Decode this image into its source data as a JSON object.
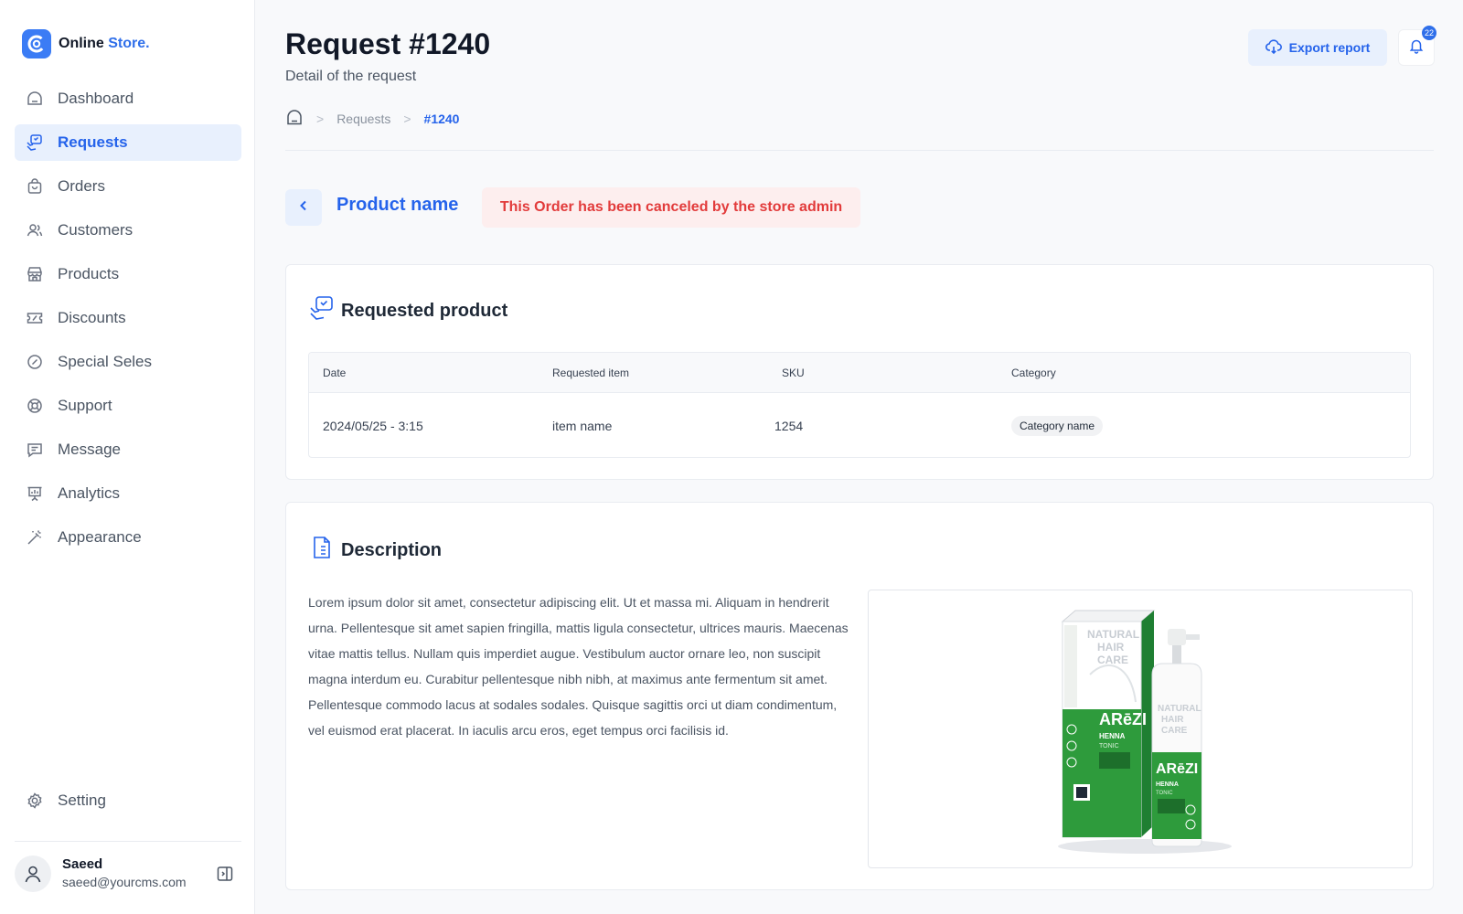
{
  "brand": {
    "name": "Online",
    "accent": "Store."
  },
  "nav": {
    "items": [
      {
        "label": "Dashboard",
        "icon": "dashboard-icon"
      },
      {
        "label": "Requests",
        "icon": "requests-icon",
        "active": true
      },
      {
        "label": "Orders",
        "icon": "shopping-bag-icon"
      },
      {
        "label": "Customers",
        "icon": "users-icon"
      },
      {
        "label": "Products",
        "icon": "store-icon"
      },
      {
        "label": "Discounts",
        "icon": "ticket-icon"
      },
      {
        "label": "Special Seles",
        "icon": "badge-percent-icon"
      },
      {
        "label": "Support",
        "icon": "lifebuoy-icon"
      },
      {
        "label": "Message",
        "icon": "message-icon"
      },
      {
        "label": "Analytics",
        "icon": "presentation-chart-icon"
      },
      {
        "label": "Appearance",
        "icon": "magic-wand-icon"
      }
    ],
    "setting_label": "Setting"
  },
  "user": {
    "name": "Saeed",
    "email": "saeed@yourcms.com"
  },
  "header": {
    "title": "Request #1240",
    "subtitle": "Detail of the request",
    "export_label": "Export report",
    "notification_count": "22"
  },
  "breadcrumb": {
    "items": [
      "Requests"
    ],
    "current": "#1240"
  },
  "request": {
    "product_name": "Product name",
    "cancel_message": "This Order has been canceled by the store admin"
  },
  "requested_product": {
    "title": "Requested product",
    "columns": [
      "Date",
      "Requested item",
      "SKU",
      "Category"
    ],
    "row": {
      "date": "2024/05/25 - 3:15",
      "item": "item name",
      "sku": "1254",
      "category": "Category name"
    }
  },
  "description": {
    "title": "Description",
    "text": "Lorem ipsum dolor sit amet, consectetur adipiscing elit. Ut et massa mi. Aliquam in hendrerit urna. Pellentesque sit amet sapien fringilla, mattis ligula consectetur, ultrices mauris. Maecenas vitae mattis tellus. Nullam quis imperdiet augue. Vestibulum auctor ornare leo, non suscipit magna interdum eu. Curabitur pellentesque nibh nibh, at maximus ante fermentum sit amet. Pellentesque commodo lacus at sodales sodales. Quisque sagittis orci ut diam condimentum, vel euismod erat placerat. In iaculis arcu eros, eget tempus orci facilisis id.",
    "image": {
      "box_label_1": "NATURAL",
      "box_label_2": "HAIR",
      "box_label_3": "CARE",
      "brand": "ARēZI",
      "product_line_1": "HENNA",
      "product_line_2": "TONIC"
    }
  },
  "colors": {
    "accent": "#2563eb",
    "danger": "#e23b3b",
    "product_green": "#2e9b3c"
  }
}
